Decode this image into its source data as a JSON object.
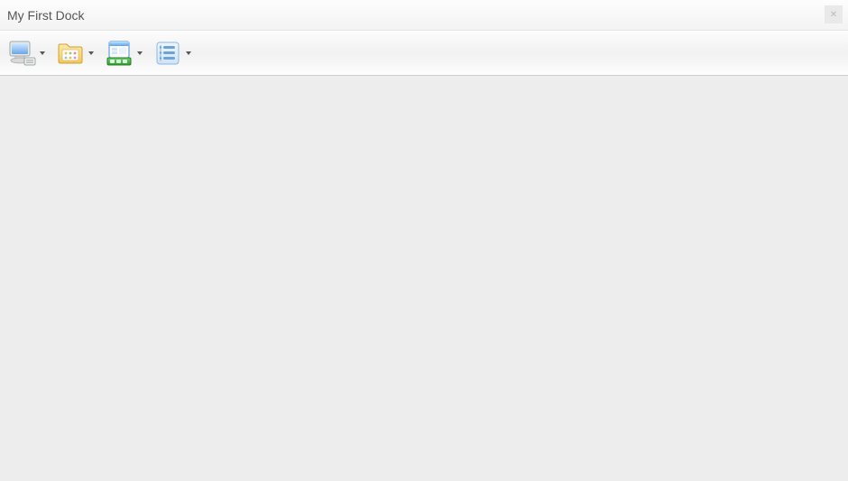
{
  "window": {
    "title": "My First Dock"
  },
  "toolbar": {
    "items": [
      {
        "id": "computer",
        "icon": "computer-icon",
        "has_dropdown": true
      },
      {
        "id": "folder",
        "icon": "folder-icon",
        "has_dropdown": true
      },
      {
        "id": "programs",
        "icon": "programs-icon",
        "has_dropdown": true
      },
      {
        "id": "list",
        "icon": "list-icon",
        "has_dropdown": true
      }
    ]
  }
}
